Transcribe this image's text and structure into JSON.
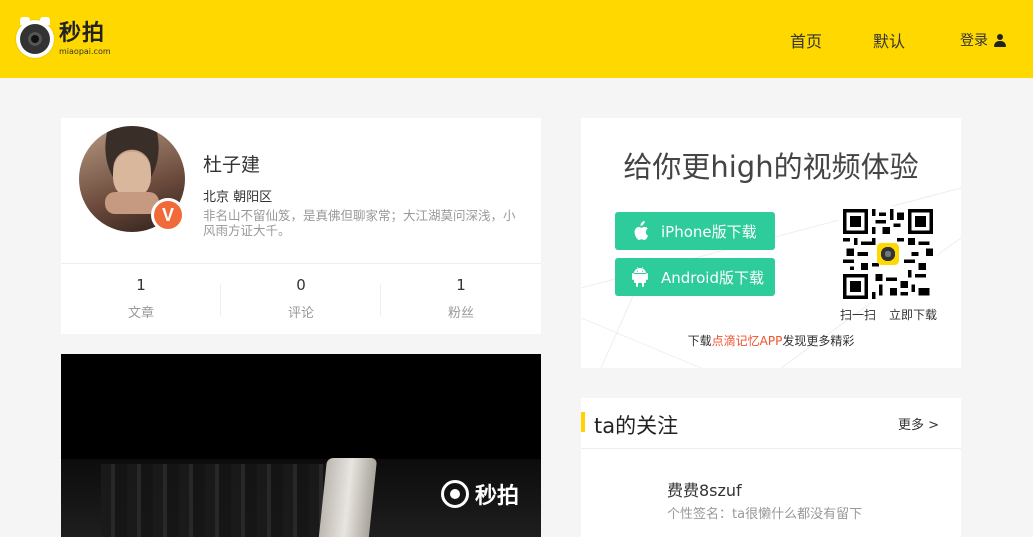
{
  "header": {
    "logo_text": "秒拍",
    "logo_subtext": "miaopai.com",
    "nav": {
      "home": "首页",
      "default": "默认",
      "login": "登录"
    }
  },
  "profile": {
    "name": "杜子建",
    "location": "北京 朝阳区",
    "signature": "非名山不留仙笈，是真佛但聊家常；大江湖莫问深浅，小风雨方证大千。",
    "badge": "V",
    "stats": [
      {
        "value": "1",
        "label": "文章"
      },
      {
        "value": "0",
        "label": "评论"
      },
      {
        "value": "1",
        "label": "粉丝"
      }
    ]
  },
  "video": {
    "watermark": "秒拍"
  },
  "promo": {
    "title": "给你更high的视频体验",
    "iphone_button": "iPhone版下载",
    "android_button": "Android版下载",
    "qr_label_scan": "扫一扫",
    "qr_label_download": "立即下载",
    "footer_prefix": "下载",
    "footer_highlight": "点滴记忆APP",
    "footer_suffix": "发现更多精彩"
  },
  "following": {
    "title": "ta的关注",
    "more": "更多 >",
    "items": [
      {
        "name": "费费8szuf",
        "signature": "个性签名：ta很懒什么都没有留下"
      }
    ]
  },
  "colors": {
    "header_bg": "#ffd800",
    "accent_green": "#2ecc9a",
    "badge_orange": "#f06a3a",
    "highlight_red": "#f0522c"
  }
}
